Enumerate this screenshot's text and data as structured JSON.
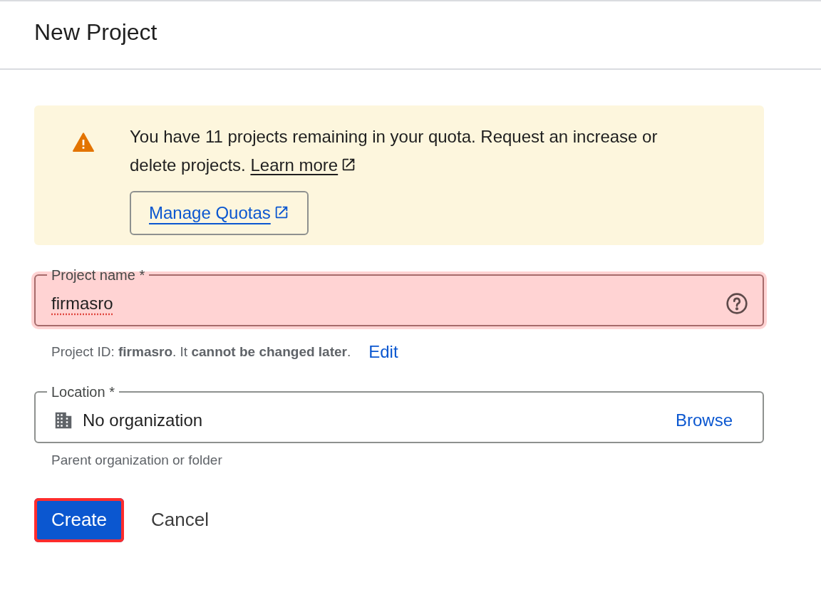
{
  "dialog": {
    "title": "New Project"
  },
  "quota_notice": {
    "text": "You have 11 projects remaining in your quota. Request an increase or delete projects.",
    "link": "Learn more",
    "button": "Manage Quotas"
  },
  "fields": [
    {
      "kind": "text",
      "label": "Project name *",
      "value": "firmasro",
      "highlighted": true,
      "helper": "Project ID: **firmasro**. It **cannot be changed later**.",
      "action": "Edit"
    },
    {
      "kind": "location",
      "label": "Location *",
      "value": "No organization",
      "highlighted": false,
      "helper": "Parent organization or folder",
      "action": "Browse"
    }
  ],
  "buttons": [
    {
      "label": "Create",
      "kind": "primary",
      "highlighted": true
    },
    {
      "label": "Cancel",
      "kind": "text",
      "highlighted": false
    }
  ]
}
